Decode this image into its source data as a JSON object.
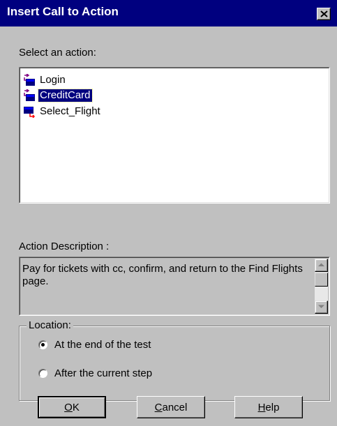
{
  "dialog": {
    "title": "Insert Call to Action",
    "close_glyph": "✕"
  },
  "actions": {
    "label": "Select an action:",
    "items": [
      {
        "label": "Login",
        "icon": "reusable-action-icon",
        "selected": false
      },
      {
        "label": "CreditCard",
        "icon": "reusable-action-icon",
        "selected": true
      },
      {
        "label": "Select_Flight",
        "icon": "action-icon",
        "selected": false
      }
    ]
  },
  "description": {
    "label": "Action Description :",
    "text": "Pay for tickets with cc, confirm, and return to the Find Flights page."
  },
  "location": {
    "label": "Location:",
    "options": [
      {
        "label": "At the end of the test",
        "checked": true
      },
      {
        "label": "After the current step",
        "checked": false
      }
    ]
  },
  "buttons": {
    "ok": {
      "mnemonic": "O",
      "rest": "K"
    },
    "cancel": {
      "mnemonic": "C",
      "rest": "ancel"
    },
    "help": {
      "mnemonic": "H",
      "rest": "elp"
    }
  },
  "colors": {
    "titlebar": "#00007f",
    "face": "#c0c0c0",
    "selection": "#00007f"
  }
}
